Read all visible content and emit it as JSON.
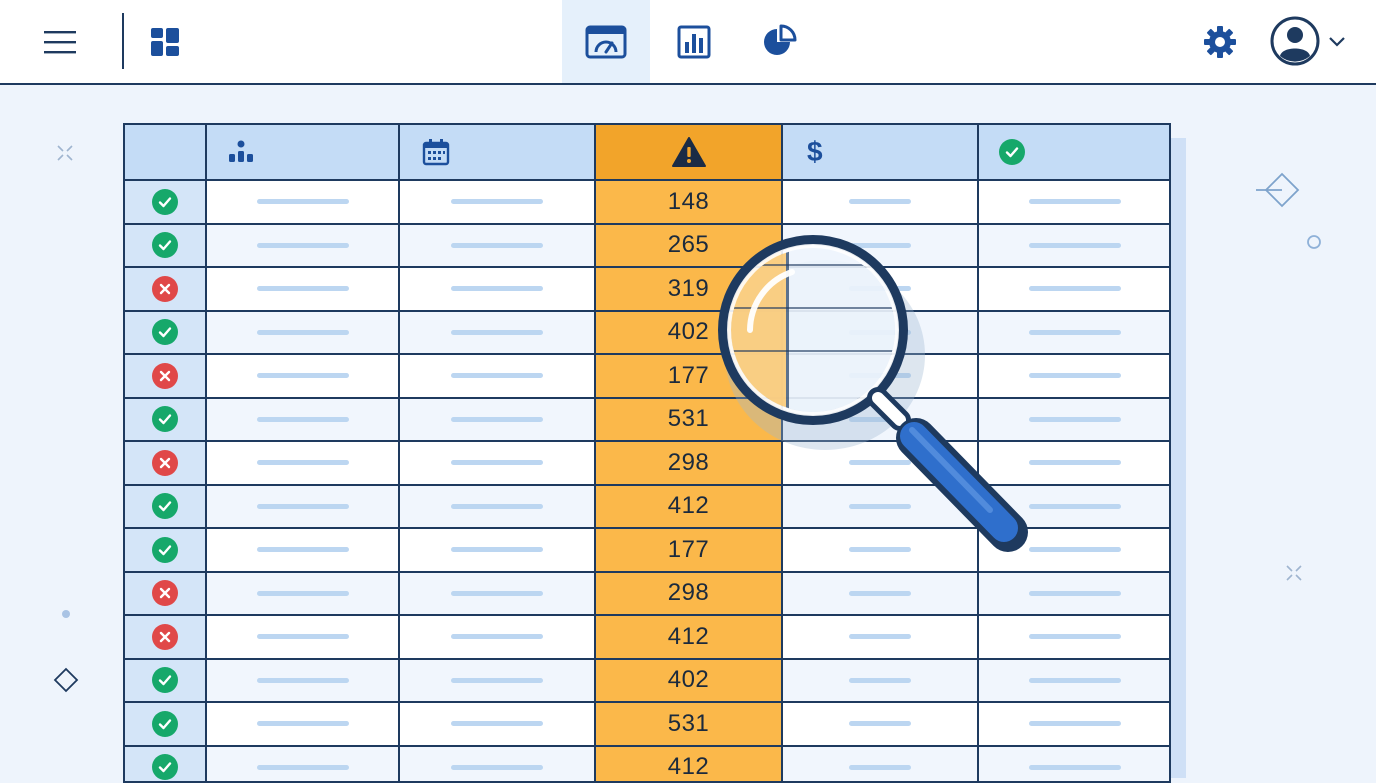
{
  "topbar": {
    "menu_icon": "hamburger-icon",
    "dashboard_icon": "dashboard-grid-icon",
    "tabs": [
      {
        "icon": "gauge-dashboard-icon",
        "active": true
      },
      {
        "icon": "bar-chart-icon",
        "active": false
      },
      {
        "icon": "pie-chart-icon",
        "active": false
      }
    ],
    "settings_icon": "gear-icon",
    "avatar_icon": "user-avatar-icon",
    "dropdown_icon": "chevron-down-icon"
  },
  "table": {
    "header_icons": [
      "hierarchy-icon",
      "calendar-icon",
      "warning-icon",
      "dollar-icon",
      "check-circle-icon"
    ],
    "header_dollar": "$",
    "highlight_color": "#fbb84a",
    "rows": [
      {
        "status": "ok",
        "value": "148"
      },
      {
        "status": "ok",
        "value": "265"
      },
      {
        "status": "bad",
        "value": "319"
      },
      {
        "status": "ok",
        "value": "402"
      },
      {
        "status": "bad",
        "value": "177"
      },
      {
        "status": "ok",
        "value": "531"
      },
      {
        "status": "bad",
        "value": "298"
      },
      {
        "status": "ok",
        "value": "412"
      },
      {
        "status": "ok",
        "value": "177"
      },
      {
        "status": "bad",
        "value": "298"
      },
      {
        "status": "bad",
        "value": "412"
      },
      {
        "status": "ok",
        "value": "402"
      },
      {
        "status": "ok",
        "value": "531"
      },
      {
        "status": "ok",
        "value": "412"
      }
    ]
  },
  "colors": {
    "accent": "#1c4f9c",
    "ok": "#16a86a",
    "bad": "#e04848",
    "header": "#c4dcf6",
    "highlight_header": "#f2a42a"
  },
  "overlay": {
    "icon": "magnifying-glass-icon"
  }
}
